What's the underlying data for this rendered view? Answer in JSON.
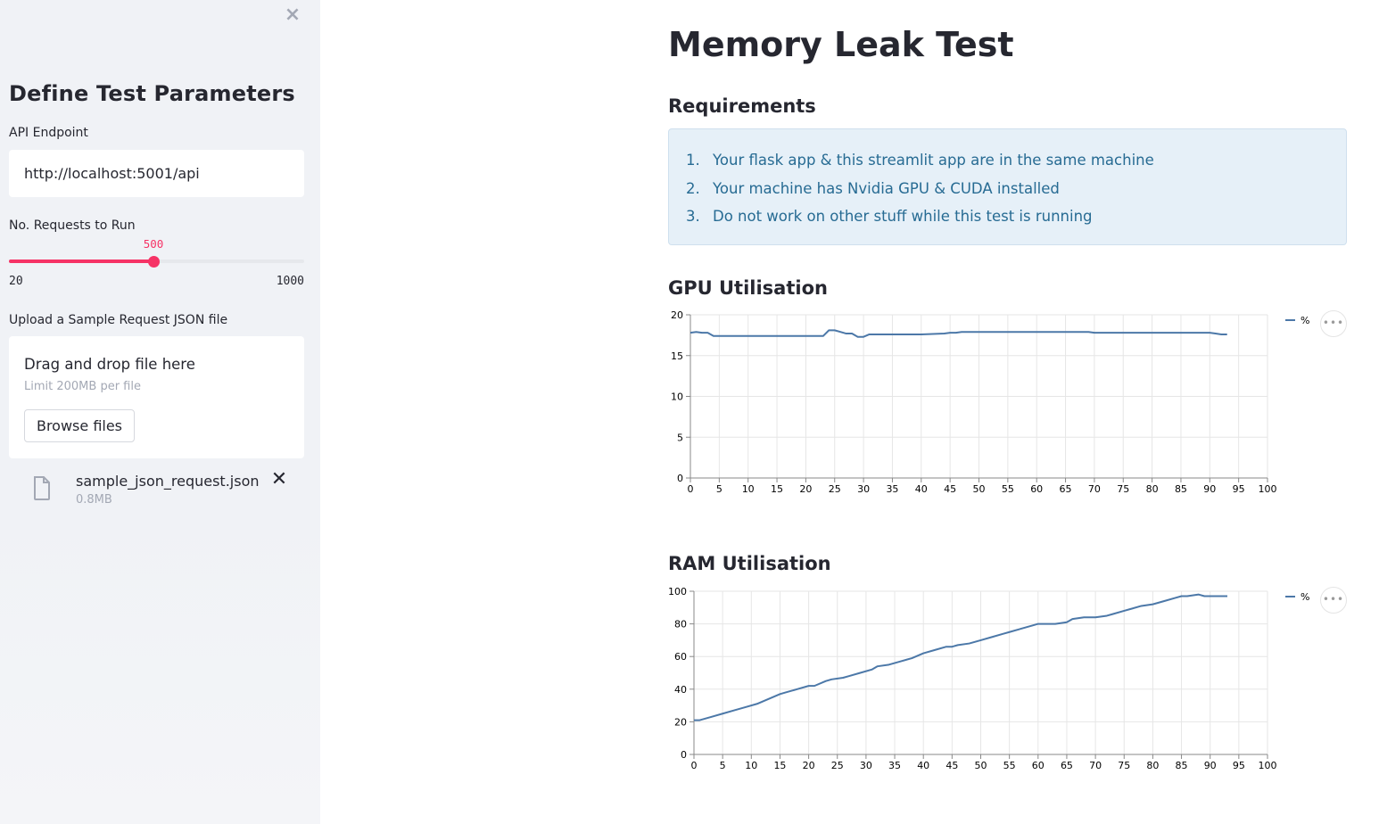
{
  "sidebar": {
    "title": "Define Test Parameters",
    "endpoint_label": "API Endpoint",
    "endpoint_value": "http://localhost:5001/api",
    "requests_label": "No. Requests to Run",
    "requests_value": "500",
    "requests_min": "20",
    "requests_max": "1000",
    "requests_fraction": 0.49,
    "upload_label": "Upload a Sample Request JSON file",
    "dropzone_title": "Drag and drop file here",
    "dropzone_limit": "Limit 200MB per file",
    "browse_label": "Browse files",
    "file": {
      "name": "sample_json_request.json",
      "size": "0.8MB"
    },
    "close_icon": "×",
    "remove_icon": "✕"
  },
  "main": {
    "title": "Memory Leak Test",
    "requirements_heading": "Requirements",
    "requirements": [
      {
        "num": "1.",
        "text": "Your flask app & this streamlit app are in the same machine"
      },
      {
        "num": "2.",
        "text": "Your machine has Nvidia GPU & CUDA installed"
      },
      {
        "num": "3.",
        "text": "Do not work on other stuff while this test is running"
      }
    ],
    "gpu_heading": "GPU Utilisation",
    "ram_heading": "RAM Utilisation",
    "menu_icon": "•••"
  },
  "colors": {
    "accent": "#f63366",
    "line": "#4c78a8",
    "info_text": "#276b93",
    "info_bg": "#e6f0f8"
  },
  "chart_data": [
    {
      "type": "line",
      "title": "GPU Utilisation",
      "ylim": [
        0,
        20
      ],
      "xlim": [
        0,
        100
      ],
      "yticks": [
        0,
        5,
        10,
        15,
        20
      ],
      "xticks": [
        0,
        5,
        10,
        15,
        20,
        25,
        30,
        35,
        40,
        45,
        50,
        55,
        60,
        65,
        70,
        75,
        80,
        85,
        90,
        95,
        100
      ],
      "legend": "top-right",
      "series": [
        {
          "name": "%",
          "x": [
            0,
            1,
            2,
            3,
            4,
            5,
            10,
            15,
            20,
            23,
            24,
            25,
            26,
            27,
            28,
            29,
            30,
            31,
            32,
            35,
            40,
            44,
            45,
            46,
            47,
            50,
            55,
            60,
            65,
            68,
            69,
            70,
            75,
            80,
            85,
            90,
            91,
            92,
            93
          ],
          "y": [
            17.8,
            17.9,
            17.8,
            17.8,
            17.4,
            17.4,
            17.4,
            17.4,
            17.4,
            17.4,
            18.1,
            18.1,
            17.9,
            17.7,
            17.7,
            17.3,
            17.3,
            17.6,
            17.6,
            17.6,
            17.6,
            17.7,
            17.8,
            17.8,
            17.9,
            17.9,
            17.9,
            17.9,
            17.9,
            17.9,
            17.9,
            17.8,
            17.8,
            17.8,
            17.8,
            17.8,
            17.7,
            17.6,
            17.6
          ]
        }
      ]
    },
    {
      "type": "line",
      "title": "RAM Utilisation",
      "ylim": [
        0,
        100
      ],
      "xlim": [
        0,
        100
      ],
      "yticks": [
        0,
        20,
        40,
        60,
        80,
        100
      ],
      "xticks": [
        0,
        5,
        10,
        15,
        20,
        25,
        30,
        35,
        40,
        45,
        50,
        55,
        60,
        65,
        70,
        75,
        80,
        85,
        90,
        95,
        100
      ],
      "legend": "top-right",
      "series": [
        {
          "name": "%",
          "x": [
            0,
            1,
            3,
            5,
            7,
            9,
            11,
            13,
            15,
            16,
            18,
            20,
            21,
            23,
            24,
            26,
            27,
            29,
            31,
            32,
            34,
            36,
            38,
            40,
            42,
            44,
            45,
            46,
            48,
            50,
            52,
            54,
            55,
            57,
            59,
            60,
            62,
            63,
            65,
            66,
            68,
            70,
            72,
            73,
            75,
            76,
            78,
            80,
            82,
            84,
            85,
            86,
            88,
            89,
            90,
            91,
            92,
            93
          ],
          "y": [
            21,
            21,
            23,
            25,
            27,
            29,
            31,
            34,
            37,
            38,
            40,
            42,
            42,
            45,
            46,
            47,
            48,
            50,
            52,
            54,
            55,
            57,
            59,
            62,
            64,
            66,
            66,
            67,
            68,
            70,
            72,
            74,
            75,
            77,
            79,
            80,
            80,
            80,
            81,
            83,
            84,
            84,
            85,
            86,
            88,
            89,
            91,
            92,
            94,
            96,
            97,
            97,
            98,
            97,
            97,
            97,
            97,
            97
          ]
        }
      ]
    }
  ]
}
